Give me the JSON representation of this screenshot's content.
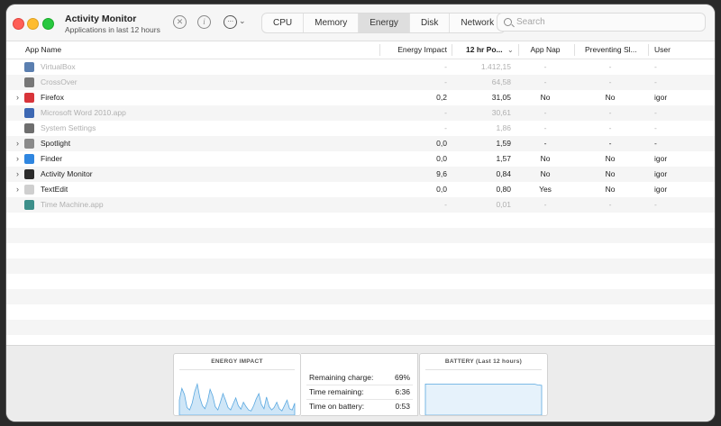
{
  "window": {
    "title": "Activity Monitor",
    "subtitle": "Applications in last 12 hours"
  },
  "toolbar": {
    "tabs": [
      {
        "label": "CPU",
        "active": false
      },
      {
        "label": "Memory",
        "active": false
      },
      {
        "label": "Energy",
        "active": true
      },
      {
        "label": "Disk",
        "active": false
      },
      {
        "label": "Network",
        "active": false
      }
    ],
    "search_placeholder": "Search"
  },
  "table": {
    "columns": {
      "app_name": "App Name",
      "energy_impact": "Energy Impact",
      "hr12_power": "12 hr Po...",
      "app_nap": "App Nap",
      "preventing_sleep": "Preventing Sl...",
      "user": "User"
    },
    "rows": [
      {
        "name": "VirtualBox",
        "energy": "-",
        "power": "1.412,15",
        "nap": "-",
        "prevent": "-",
        "user": "-",
        "dim": true,
        "expand": false,
        "icon": "virtualbox-icon",
        "color": "#5b7fb0"
      },
      {
        "name": "CrossOver",
        "energy": "-",
        "power": "64,58",
        "nap": "-",
        "prevent": "-",
        "user": "-",
        "dim": true,
        "expand": false,
        "icon": "crossover-icon",
        "color": "#777777"
      },
      {
        "name": "Firefox",
        "energy": "0,2",
        "power": "31,05",
        "nap": "No",
        "prevent": "No",
        "user": "igor",
        "dim": false,
        "expand": true,
        "icon": "firefox-icon",
        "color": "#d8343a"
      },
      {
        "name": "Microsoft Word 2010.app",
        "energy": "-",
        "power": "30,61",
        "nap": "-",
        "prevent": "-",
        "user": "-",
        "dim": true,
        "expand": false,
        "icon": "word-icon",
        "color": "#3d68b3"
      },
      {
        "name": "System Settings",
        "energy": "-",
        "power": "1,86",
        "nap": "-",
        "prevent": "-",
        "user": "-",
        "dim": true,
        "expand": false,
        "icon": "settings-gear-icon",
        "color": "#6e6e6e"
      },
      {
        "name": "Spotlight",
        "energy": "0,0",
        "power": "1,59",
        "nap": "-",
        "prevent": "-",
        "user": "-",
        "dim": false,
        "expand": true,
        "icon": "spotlight-icon",
        "color": "#8a8a8a"
      },
      {
        "name": "Finder",
        "energy": "0,0",
        "power": "1,57",
        "nap": "No",
        "prevent": "No",
        "user": "igor",
        "dim": false,
        "expand": true,
        "icon": "finder-icon",
        "color": "#2f86e0"
      },
      {
        "name": "Activity Monitor",
        "energy": "9,6",
        "power": "0,84",
        "nap": "No",
        "prevent": "No",
        "user": "igor",
        "dim": false,
        "expand": true,
        "icon": "activity-monitor-icon",
        "color": "#2b2b2b"
      },
      {
        "name": "TextEdit",
        "energy": "0,0",
        "power": "0,80",
        "nap": "Yes",
        "prevent": "No",
        "user": "igor",
        "dim": false,
        "expand": true,
        "icon": "textedit-icon",
        "color": "#cfcfcf"
      },
      {
        "name": "Time Machine.app",
        "energy": "-",
        "power": "0,01",
        "nap": "-",
        "prevent": "-",
        "user": "-",
        "dim": true,
        "expand": false,
        "icon": "time-machine-icon",
        "color": "#3d8f8a"
      }
    ]
  },
  "energy_panel": {
    "title": "ENERGY IMPACT",
    "history": [
      0.35,
      0.62,
      0.48,
      0.18,
      0.12,
      0.28,
      0.55,
      0.72,
      0.4,
      0.22,
      0.15,
      0.32,
      0.6,
      0.45,
      0.2,
      0.12,
      0.3,
      0.5,
      0.35,
      0.18,
      0.12,
      0.26,
      0.4,
      0.22,
      0.14,
      0.3,
      0.2,
      0.12,
      0.1,
      0.22,
      0.38,
      0.5,
      0.25,
      0.15,
      0.42,
      0.2,
      0.12,
      0.18,
      0.3,
      0.15,
      0.1,
      0.22,
      0.35,
      0.15,
      0.12,
      0.28
    ]
  },
  "stats_panel": {
    "remaining_charge_label": "Remaining charge:",
    "remaining_charge_value": "69%",
    "time_remaining_label": "Time remaining:",
    "time_remaining_value": "6:36",
    "time_on_battery_label": "Time on battery:",
    "time_on_battery_value": "0:53"
  },
  "battery_panel": {
    "title": "BATTERY (Last 12 hours)",
    "history": [
      0.72,
      0.72,
      0.72,
      0.72,
      0.72,
      0.72,
      0.72,
      0.72,
      0.72,
      0.72,
      0.72,
      0.72,
      0.72,
      0.72,
      0.72,
      0.72,
      0.72,
      0.72,
      0.72,
      0.72,
      0.72,
      0.72,
      0.72,
      0.72,
      0.72,
      0.72,
      0.72,
      0.72,
      0.72,
      0.7,
      0.69
    ]
  }
}
